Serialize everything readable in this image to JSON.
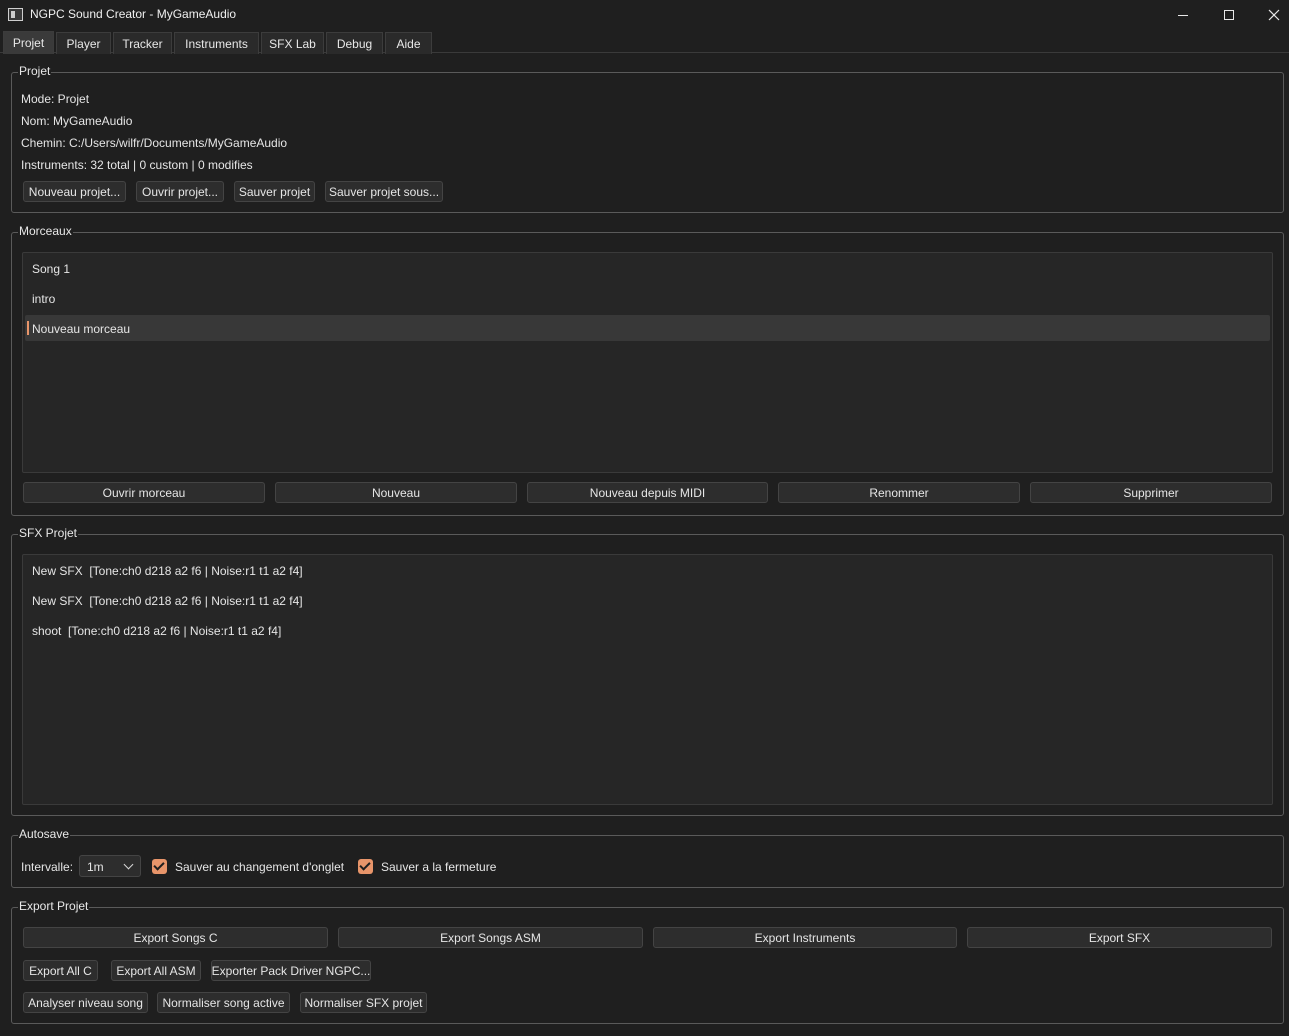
{
  "window": {
    "title": "NGPC Sound Creator - MyGameAudio",
    "minimize_icon": "minimize-icon",
    "maximize_icon": "maximize-icon",
    "close_icon": "close-icon"
  },
  "tabs": [
    {
      "label": "Projet",
      "active": true
    },
    {
      "label": "Player"
    },
    {
      "label": "Tracker"
    },
    {
      "label": "Instruments"
    },
    {
      "label": "SFX Lab"
    },
    {
      "label": "Debug"
    },
    {
      "label": "Aide"
    }
  ],
  "projet": {
    "group_title": "Projet",
    "mode": "Mode: Projet",
    "nom": "Nom: MyGameAudio",
    "chemin": "Chemin: C:/Users/wilfr/Documents/MyGameAudio",
    "instruments": "Instruments: 32 total | 0 custom | 0 modifies",
    "buttons": {
      "nouveau": "Nouveau projet...",
      "ouvrir": "Ouvrir projet...",
      "sauver": "Sauver projet",
      "sauver_sous": "Sauver projet sous..."
    }
  },
  "morceaux": {
    "group_title": "Morceaux",
    "items": [
      "Song 1",
      "intro",
      "Nouveau morceau"
    ],
    "selected_index": 2,
    "buttons": {
      "ouvrir": "Ouvrir morceau",
      "nouveau": "Nouveau",
      "nouveau_midi": "Nouveau depuis MIDI",
      "renommer": "Renommer",
      "supprimer": "Supprimer"
    }
  },
  "sfx": {
    "group_title": "SFX Projet",
    "items": [
      "New SFX  [Tone:ch0 d218 a2 f6 | Noise:r1 t1 a2 f4]",
      "New SFX  [Tone:ch0 d218 a2 f6 | Noise:r1 t1 a2 f4]",
      "shoot  [Tone:ch0 d218 a2 f6 | Noise:r1 t1 a2 f4]"
    ]
  },
  "autosave": {
    "group_title": "Autosave",
    "interval_label": "Intervalle:",
    "interval_value": "1m",
    "check_tab_label": "Sauver au changement d'onglet",
    "check_tab_checked": true,
    "check_close_label": "Sauver a la fermeture",
    "check_close_checked": true
  },
  "export": {
    "group_title": "Export Projet",
    "buttons": {
      "songs_c": "Export Songs C",
      "songs_asm": "Export Songs ASM",
      "instruments": "Export Instruments",
      "sfx": "Export SFX",
      "all_c": "Export All C",
      "all_asm": "Export All ASM",
      "pack_driver": "Exporter Pack Driver NGPC...",
      "analyser": "Analyser niveau song",
      "normaliser_song": "Normaliser song active",
      "normaliser_sfx": "Normaliser SFX projet"
    }
  },
  "colors": {
    "accent": "#e8956a",
    "background": "#1f1f1f"
  }
}
